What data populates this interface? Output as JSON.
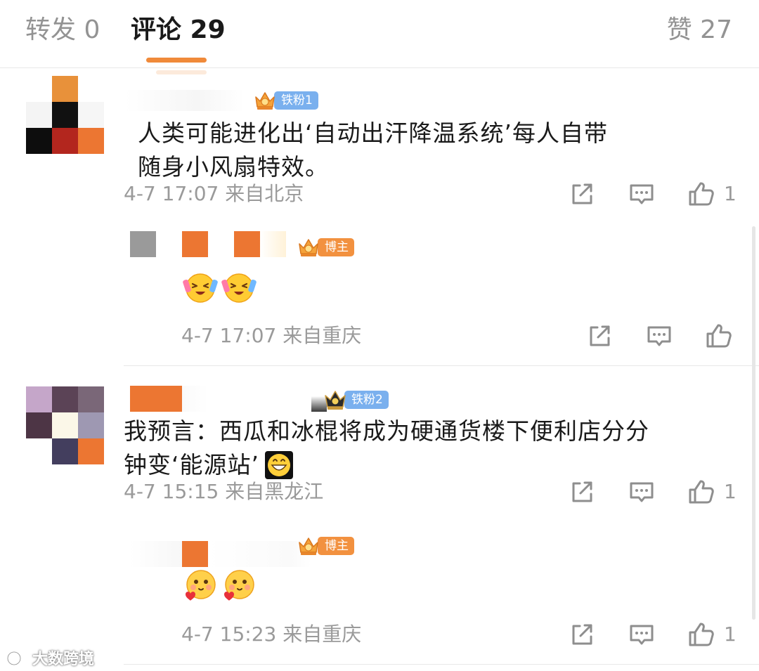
{
  "tabs": {
    "repost": "转发 0",
    "comments": "评论 29",
    "likes": "赞 27"
  },
  "comments": [
    {
      "badge": "铁粉1",
      "text_line1": "人类可能进化出‘自动出汗降温系统’每人自带",
      "text_line2": "随身小风扇特效。",
      "meta": "4-7 17:07 来自北京",
      "likes": "1",
      "reply": {
        "badge": "博主",
        "emoji": "hot-face-fan-emoji",
        "meta": "4-7 17:07 来自重庆"
      }
    },
    {
      "badge": "铁粉2",
      "text_line1": "我预言：西瓜和冰棍将成为硬通货楼下便利店分分",
      "text_line2": "钟变‘能源站’",
      "meta": "4-7 15:15 来自黑龙江",
      "likes": "1",
      "reply": {
        "badge": "博主",
        "emoji": "blushing-heart-emoji",
        "meta": "4-7 15:23 来自重庆",
        "likes": "1"
      }
    }
  ],
  "watermark": "大数跨境",
  "icons": [
    "repost-icon",
    "comment-icon",
    "like-icon",
    "crown-icon"
  ],
  "colors": {
    "accent": "#f08a3a",
    "fan_badge": "#7ab0ee",
    "host_badge": "#f2913f",
    "meta_text": "#9a9a9a"
  }
}
